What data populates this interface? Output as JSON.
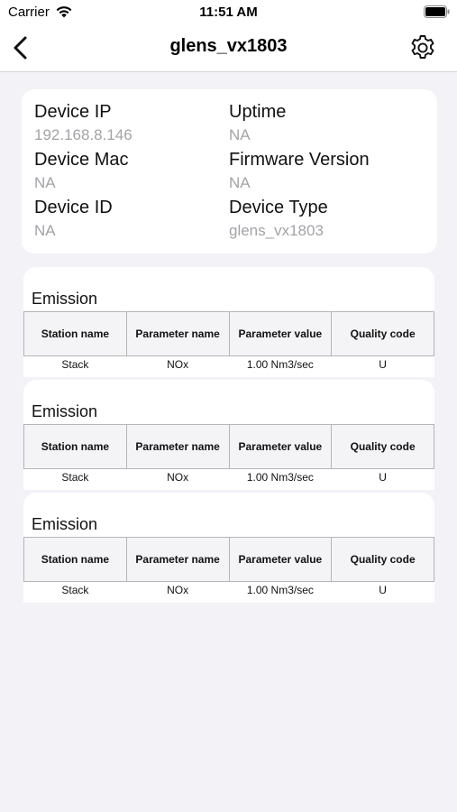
{
  "status_bar": {
    "carrier": "Carrier",
    "time": "11:51 AM"
  },
  "nav": {
    "title": "glens_vx1803"
  },
  "device_info": {
    "ip_label": "Device IP",
    "ip_value": "192.168.8.146",
    "uptime_label": "Uptime",
    "uptime_value": "NA",
    "mac_label": "Device Mac",
    "mac_value": "NA",
    "fw_label": "Firmware Version",
    "fw_value": "NA",
    "id_label": "Device ID",
    "id_value": "NA",
    "type_label": "Device Type",
    "type_value": "glens_vx1803"
  },
  "emissions": [
    {
      "title": "Emission",
      "headers": [
        "Station name",
        "Parameter name",
        "Parameter value",
        "Quality code"
      ],
      "row": [
        "Stack",
        "NOx",
        "1.00 Nm3/sec",
        "U"
      ]
    },
    {
      "title": "Emission",
      "headers": [
        "Station name",
        "Parameter name",
        "Parameter value",
        "Quality code"
      ],
      "row": [
        "Stack",
        "NOx",
        "1.00 Nm3/sec",
        "U"
      ]
    },
    {
      "title": "Emission",
      "headers": [
        "Station name",
        "Parameter name",
        "Parameter value",
        "Quality code"
      ],
      "row": [
        "Stack",
        "NOx",
        "1.00 Nm3/sec",
        "U"
      ]
    }
  ],
  "icons": {
    "back": "chevron-left-icon",
    "settings": "gear-icon",
    "wifi": "wifi-icon",
    "battery": "battery-icon"
  }
}
